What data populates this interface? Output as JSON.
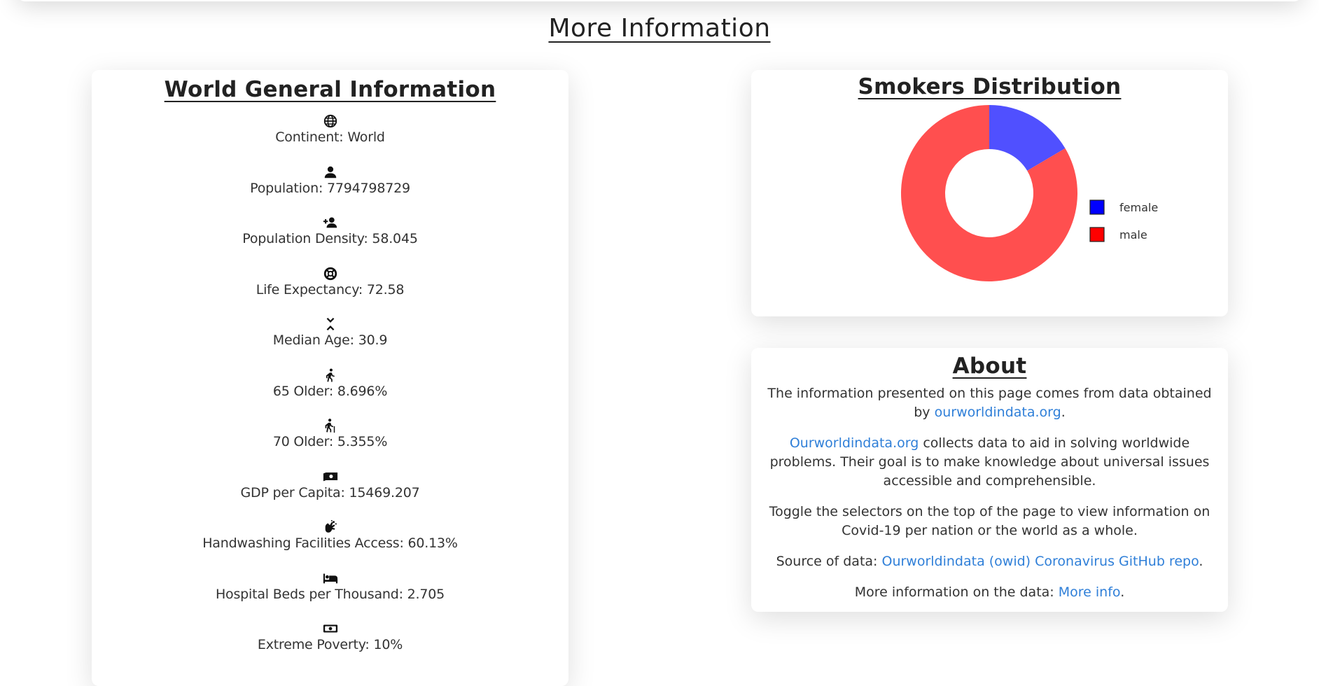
{
  "page": {
    "heading": "More Information"
  },
  "world": {
    "title": "World General Information",
    "items": [
      {
        "icon": "globe-icon",
        "label": "Continent: World"
      },
      {
        "icon": "person-icon",
        "label": "Population: 7794798729"
      },
      {
        "icon": "add-person-icon",
        "label": "Population Density: 58.045"
      },
      {
        "icon": "lifebuoy-icon",
        "label": "Life Expectancy: 72.58"
      },
      {
        "icon": "chevrons-icon",
        "label": "Median Age: 30.9"
      },
      {
        "icon": "walking-icon",
        "label": "65 Older: 8.696%"
      },
      {
        "icon": "walking-cane-icon",
        "label": "70 Older: 5.355%"
      },
      {
        "icon": "money-icon",
        "label": "GDP per Capita: 15469.207"
      },
      {
        "icon": "handwashing-icon",
        "label": "Handwashing Facilities Access: 60.13%"
      },
      {
        "icon": "bed-icon",
        "label": "Hospital Beds per Thousand: 2.705"
      },
      {
        "icon": "banknote-icon",
        "label": "Extreme Poverty: 10%"
      }
    ]
  },
  "smokers": {
    "title": "Smokers Distribution"
  },
  "chart_data": {
    "type": "pie",
    "title": "Smokers Distribution",
    "donut": true,
    "categories": [
      "female",
      "male"
    ],
    "values": [
      16.5,
      83.5
    ],
    "colors": [
      "#5050ff",
      "#ff4f4f"
    ],
    "legend_colors": [
      "#0000ff",
      "#ff0000"
    ],
    "legend_position": "right"
  },
  "about": {
    "title": "About",
    "p1_text": "The information presented on this page comes from data obtained by",
    "p1_link": "ourworldindata.org",
    "p1_end": ".",
    "p2_link": "Ourworldindata.org",
    "p2_text": " collects data to aid in solving worldwide problems. Their goal is to make knowledge about universal issues accessible and comprehensible.",
    "p3_text": "Toggle the selectors on the top of the page to view information on Covid-19 per nation or the world as a whole.",
    "p4_text": "Source of data: ",
    "p4_link": "Ourworldindata (owid) Coronavirus GitHub repo",
    "p4_end": ".",
    "p5_text": "More information on the data: ",
    "p5_link": "More info",
    "p5_end": "."
  }
}
